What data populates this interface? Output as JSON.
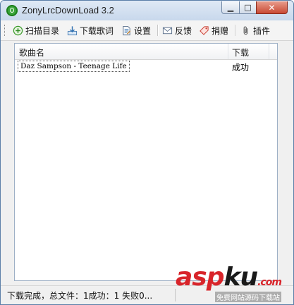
{
  "window": {
    "title": "ZonyLrcDownLoad 3.2"
  },
  "toolbar": {
    "scan_label": "扫描目录",
    "download_label": "下载歌词",
    "settings_label": "设置",
    "feedback_label": "反馈",
    "donate_label": "捐赠",
    "plugins_label": "插件"
  },
  "list": {
    "columns": [
      "歌曲名",
      "下载"
    ],
    "rows": [
      {
        "name": "Daz Sampson - Teenage Life",
        "status": "成功"
      }
    ]
  },
  "statusbar": {
    "text": "下载完成，总文件：1成功：1 失败0..."
  },
  "watermark": {
    "main": "asp",
    "main2": "ku",
    "tld": ".com",
    "sub": "免费网站源码下载站"
  },
  "colors": {
    "accent_red": "#d8242a",
    "title_gradient_top": "#dfe9f5",
    "close_button": "#c94a34"
  }
}
